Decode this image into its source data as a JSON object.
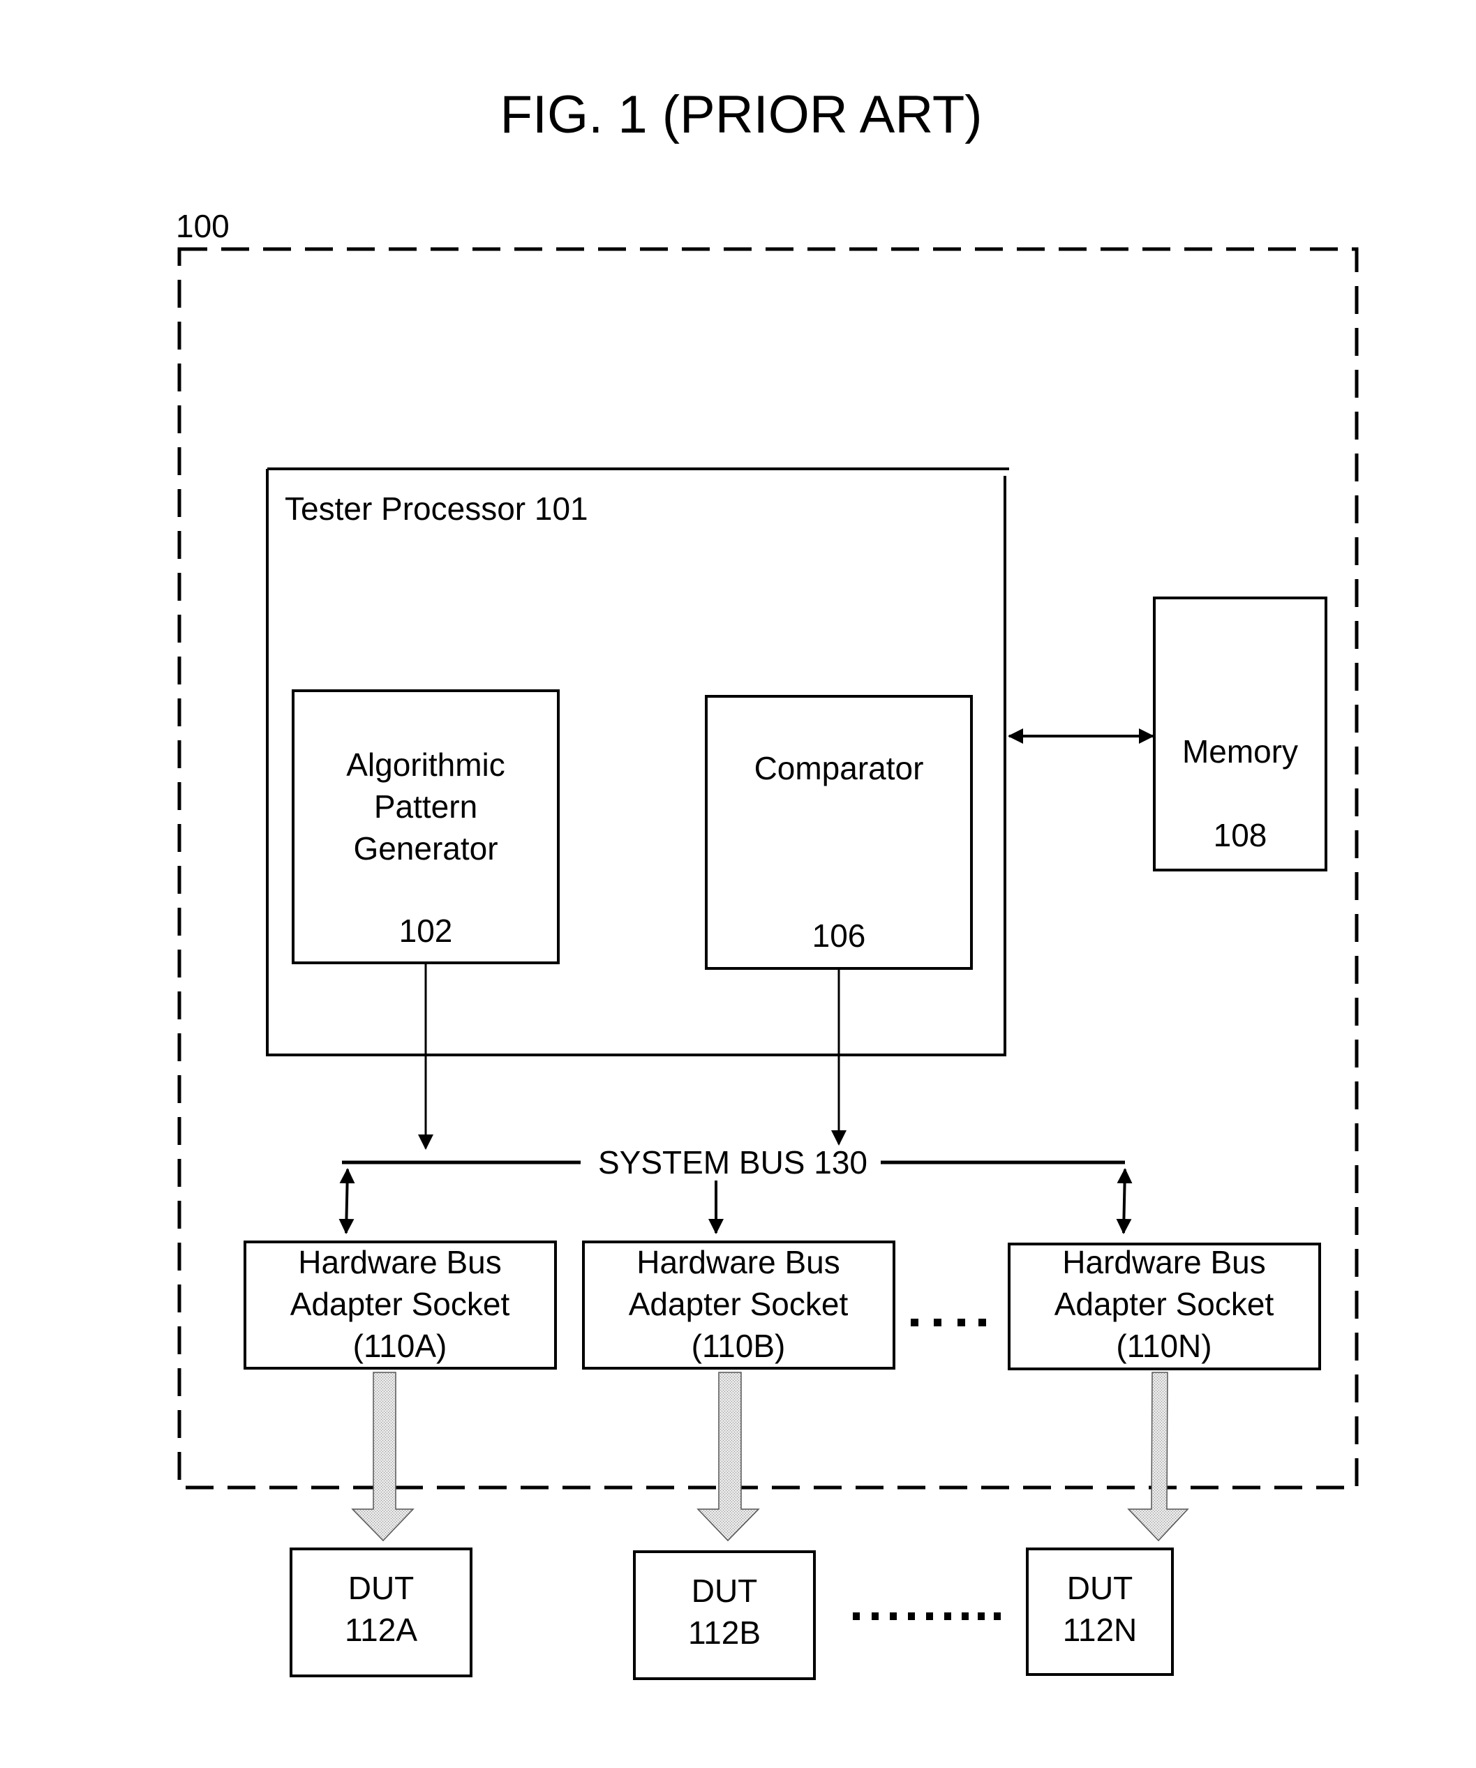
{
  "figure": {
    "title": "FIG. 1  (PRIOR ART)"
  },
  "system": {
    "ref": "100"
  },
  "tester_processor": {
    "label": "Tester Processor 101"
  },
  "pattern_generator": {
    "lines": [
      "Algorithmic",
      "Pattern",
      "Generator"
    ],
    "ref": "102"
  },
  "comparator": {
    "label": "Comparator",
    "ref": "106"
  },
  "memory": {
    "label": "Memory",
    "ref": "108"
  },
  "system_bus": {
    "label": "SYSTEM BUS 130"
  },
  "sockets": [
    {
      "line1": "Hardware Bus",
      "line2": "Adapter Socket",
      "ref": "(110A)"
    },
    {
      "line1": "Hardware Bus",
      "line2": "Adapter Socket",
      "ref": "(110B)"
    },
    {
      "line1": "Hardware Bus",
      "line2": "Adapter Socket",
      "ref": "(110N)"
    }
  ],
  "duts": [
    {
      "label": "DUT",
      "ref": "112A"
    },
    {
      "label": "DUT",
      "ref": "112B"
    },
    {
      "label": "DUT",
      "ref": "112N"
    }
  ],
  "colors": {
    "stroke": "#000000",
    "fat_arrow_fill": "#d9d9d9"
  }
}
